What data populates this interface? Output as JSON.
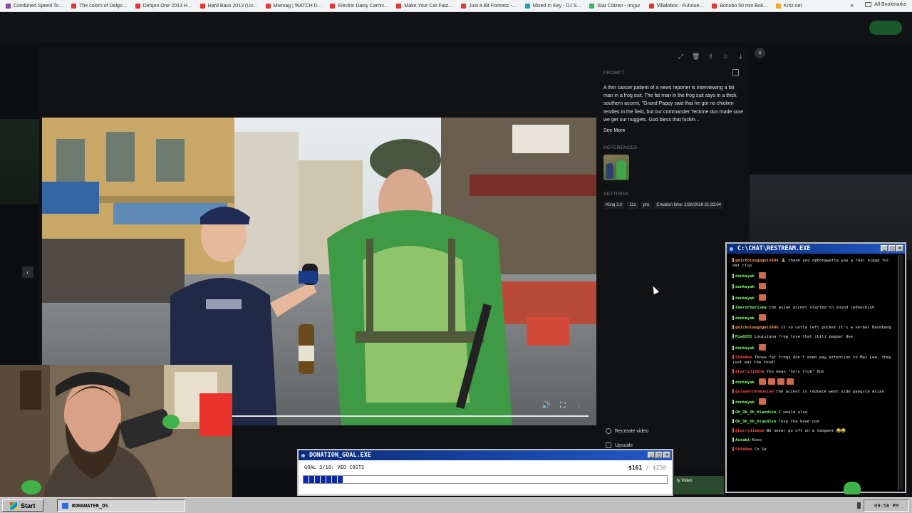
{
  "bookmarks": [
    {
      "label": "Combined Speed To...",
      "color": "#8e44ad"
    },
    {
      "label": "The colors of Delgo...",
      "color": "#e53935"
    },
    {
      "label": "Defqon One 2013 H...",
      "color": "#e53935"
    },
    {
      "label": "Hard Bass 2013 (Liv...",
      "color": "#e53935"
    },
    {
      "label": "Mixmag | WATCH D...",
      "color": "#e53935"
    },
    {
      "label": "Electric Daisy Carniv...",
      "color": "#e53935"
    },
    {
      "label": "Make Your Car Fast...",
      "color": "#e53935"
    },
    {
      "label": "Just a Bit Fortress -...",
      "color": "#e53935"
    },
    {
      "label": "Mixed In Key - DJ S...",
      "color": "#1aa3c8"
    },
    {
      "label": "Star Citizen - Imgur",
      "color": "#2dbb5d"
    },
    {
      "label": "Villalobos - Fuhoue...",
      "color": "#e53935"
    },
    {
      "label": "Bonobo 50 min Boil...",
      "color": "#e53935"
    },
    {
      "label": "Kritz.net",
      "color": "#f5a623"
    }
  ],
  "bookmarks_more": "»",
  "all_bookmarks": "All Bookmarks",
  "modal": {
    "close_icon": "×",
    "nav_prev_icon": "‹",
    "prompt_label": "PROMPT",
    "prompt_text": "A thin cancer patient of a news reporter is interviewing a fat man in a frog suit. The fat man in the frog suit says in a thick southern accent, \"Grand Pappy said that he got no chicken tendies in the field, but our commander Tectone dun made sure we get our nuggets. God bless that fuckin...",
    "see_more": "See More",
    "references_label": "REFERENCES",
    "settings_label": "SETTINGS",
    "chips": [
      "Kling 3.0",
      "11s",
      "pro",
      "Creation time: 2/28/2026 21:33:04"
    ],
    "recreate": "Recreate video",
    "upscale": "Upscale",
    "video_progress": 1.0,
    "video_controls": {
      "volume": "🔊",
      "fullscreen": "⛶",
      "more": "⋮"
    }
  },
  "chat": {
    "title": "C:\\CHAT\\RESTREAM.EXE",
    "messages": [
      {
        "user": "@nicholasgogel5606",
        "color": "#ff9a4a",
        "text": "🙏 thank you dpbongwatta you a real nigga for dat clip",
        "emotes": 0
      },
      {
        "user": "donkeyak",
        "color": "#7cff6b",
        "text": "",
        "emotes": 1
      },
      {
        "user": "donkeyak",
        "color": "#7cff6b",
        "text": "",
        "emotes": 1
      },
      {
        "user": "donkeyak",
        "color": "#7cff6b",
        "text": "",
        "emotes": 1
      },
      {
        "user": "ZeeroCharisma",
        "color": "#7cff6b",
        "text": "the asian accent started to sound redneckish",
        "emotes": 0
      },
      {
        "user": "donkeyak",
        "color": "#7cff6b",
        "text": "",
        "emotes": 1
      },
      {
        "user": "@nicholasgogel5606",
        "color": "#ff9a4a",
        "text": "It so outta left pocket it's a verbal Bashbang",
        "emotes": 0
      },
      {
        "user": "Mia0201",
        "color": "#7cff6b",
        "text": "Louisiana frog love that chili pepper doe",
        "emotes": 0
      },
      {
        "user": "donkeyak",
        "color": "#7cff6b",
        "text": "",
        "emotes": 1
      },
      {
        "user": "504eBee",
        "color": "#ff4a4a",
        "text": "Those fat frogs don't even pay attention to Mai Lee, they just eat the food!",
        "emotes": 0
      },
      {
        "user": "@LarryJimbob",
        "color": "#ff4a4a",
        "text": "You mean \"holy fluk\" Don",
        "emotes": 0
      },
      {
        "user": "donkeyak",
        "color": "#7cff6b",
        "text": "",
        "emotes": 4
      },
      {
        "user": "@slayerofmankind",
        "color": "#ff4a4a",
        "text": "the accent is redneck west side gangsta Asian",
        "emotes": 0
      },
      {
        "user": "donkeyak",
        "color": "#7cff6b",
        "text": "",
        "emotes": 1
      },
      {
        "user": "Oh_Oh_Oh_blandish",
        "color": "#7cff6b",
        "text": "I would also",
        "emotes": 0
      },
      {
        "user": "Oh_Oh_Oh_blandish",
        "color": "#7cff6b",
        "text": "love the head nod",
        "emotes": 0
      },
      {
        "user": "@LarryJimbob",
        "color": "#ff4a4a",
        "text": "We never go off on a tangent 😂😂",
        "emotes": 0
      },
      {
        "user": "Aosabi",
        "color": "#7cff6b",
        "text": "Koso",
        "emotes": 0
      },
      {
        "user": "504eBee",
        "color": "#ff4a4a",
        "text": "Co So",
        "emotes": 0
      }
    ]
  },
  "donation": {
    "title": "DONATION_GOAL.EXE",
    "goal": "GOAL 3/10: VEO COSTS",
    "current": "$161",
    "separator": " / ",
    "target": "$250",
    "progress": 0.11
  },
  "taskbar": {
    "start": "Start",
    "item": "BONGWATER_OS",
    "clock": "09:58 PM"
  },
  "fy_video": "fy Video"
}
